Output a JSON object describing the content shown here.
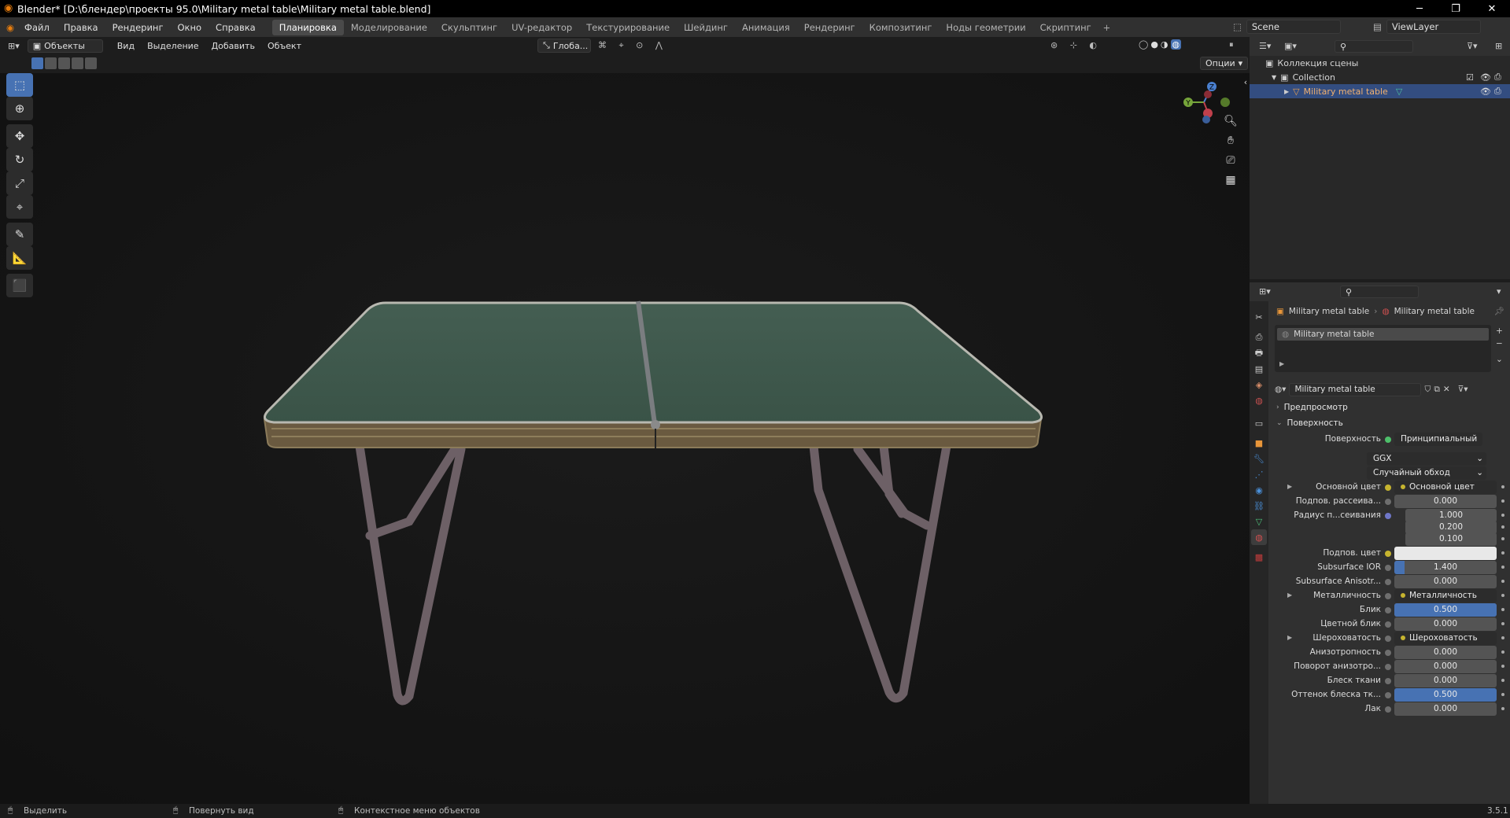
{
  "window": {
    "title": "Blender* [D:\\блендер\\проекты 95.0\\Military metal table\\Military metal table.blend]",
    "minimize": "─",
    "maximize": "❐",
    "close": "✕"
  },
  "menu": {
    "items": [
      "Файл",
      "Правка",
      "Рендеринг",
      "Окно",
      "Справка"
    ],
    "workspaces": [
      "Планировка",
      "Моделирование",
      "Скульптинг",
      "UV-редактор",
      "Текстурирование",
      "Шейдинг",
      "Анимация",
      "Рендеринг",
      "Композитинг",
      "Ноды геометрии",
      "Скриптинг"
    ],
    "active_workspace": "Планировка",
    "add_workspace": "+",
    "scene": "Scene",
    "view_layer": "ViewLayer"
  },
  "viewport_header": {
    "mode": "Объекты",
    "menus": [
      "Вид",
      "Выделение",
      "Добавить",
      "Объект"
    ],
    "orientation": "Глоба...",
    "options": "Опции"
  },
  "gizmo": {
    "z": "Z",
    "y": "Y"
  },
  "outliner": {
    "search_placeholder": "",
    "scene_collection": "Коллекция сцены",
    "collection": "Collection",
    "object": "Military metal table"
  },
  "properties": {
    "breadcrumb_object": "Military metal table",
    "breadcrumb_material": "Military metal table",
    "slot": "Military metal table",
    "material_name": "Military metal table",
    "sections": {
      "preview": "Предпросмотр",
      "surface": "Поверхность"
    },
    "surface_label": "Поверхность",
    "surface_shader": "Принципиальный BSDF",
    "distribution": "GGX",
    "subsurface_method": "Случайный обход",
    "rows": [
      {
        "label": "Основной цвет",
        "kind": "link",
        "value": "Основной цвет",
        "dot": "yellow",
        "expand": true
      },
      {
        "label": "Подпов. рассеива...",
        "kind": "num",
        "value": "0.000",
        "dot": "gray"
      },
      {
        "label": "Радиус п...сеивания",
        "kind": "vec",
        "value": "1.000",
        "dot": "blue"
      },
      {
        "label": "",
        "kind": "vec2",
        "value": "0.200"
      },
      {
        "label": "",
        "kind": "vec2",
        "value": "0.100"
      },
      {
        "label": "Подпов. цвет",
        "kind": "color",
        "value": "",
        "dot": "yellow"
      },
      {
        "label": "Subsurface IOR",
        "kind": "num",
        "value": "1.400",
        "dot": "gray",
        "fill": 0.1
      },
      {
        "label": "Subsurface Anisotr...",
        "kind": "num",
        "value": "0.000",
        "dot": "gray"
      },
      {
        "label": "Металличность",
        "kind": "link",
        "value": "Металличность",
        "dot": "gray",
        "expand": true
      },
      {
        "label": "Блик",
        "kind": "num",
        "value": "0.500",
        "dot": "gray",
        "fill": 1.0
      },
      {
        "label": "Цветной блик",
        "kind": "num",
        "value": "0.000",
        "dot": "gray"
      },
      {
        "label": "Шероховатость",
        "kind": "link",
        "value": "Шероховатость",
        "dot": "gray",
        "expand": true
      },
      {
        "label": "Анизотропность",
        "kind": "num",
        "value": "0.000",
        "dot": "gray"
      },
      {
        "label": "Поворот анизотро...",
        "kind": "num",
        "value": "0.000",
        "dot": "gray"
      },
      {
        "label": "Блеск ткани",
        "kind": "num",
        "value": "0.000",
        "dot": "gray"
      },
      {
        "label": "Оттенок блеска тк...",
        "kind": "num",
        "value": "0.500",
        "dot": "gray",
        "fill": 1.0
      },
      {
        "label": "Лак",
        "kind": "num",
        "value": "0.000",
        "dot": "gray"
      }
    ]
  },
  "status": {
    "select": "Выделить",
    "rotate": "Повернуть вид",
    "context": "Контекстное меню объектов",
    "version": "3.5.1"
  },
  "colors": {
    "accent": "#4772b3",
    "selection": "#334d80",
    "table_top": "#3f5a4e",
    "viewport_bg": "#151515"
  }
}
